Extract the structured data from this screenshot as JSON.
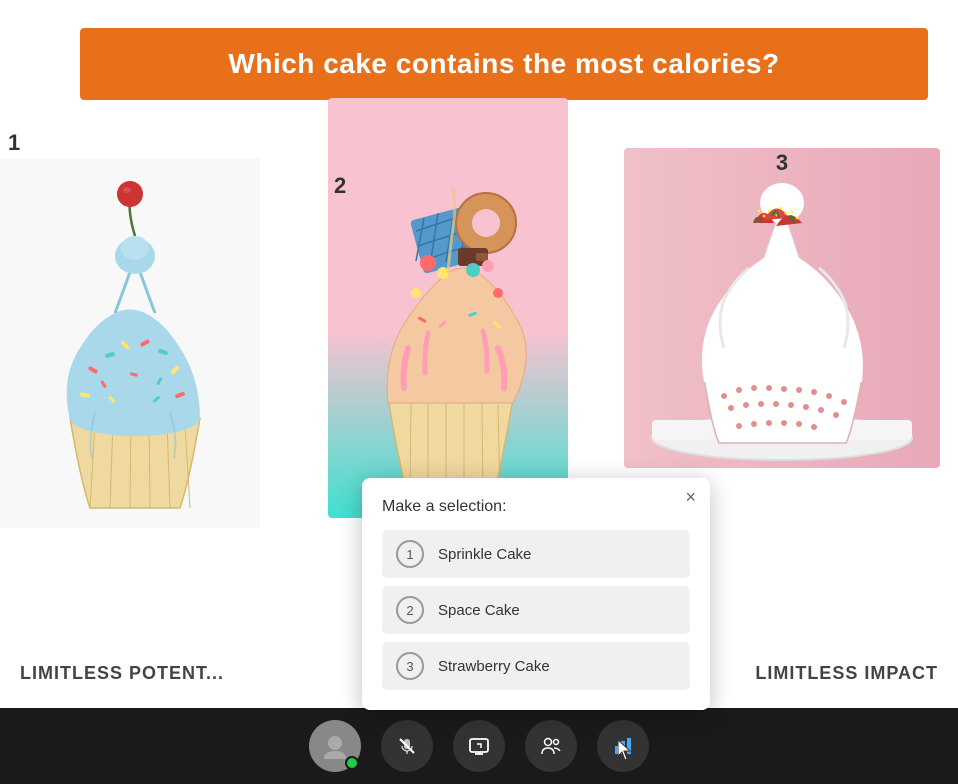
{
  "question": {
    "text": "Which cake contains the most calories?"
  },
  "cakes": [
    {
      "number": "1",
      "name": "Sprinkle Cake"
    },
    {
      "number": "2",
      "name": "Space Cake"
    },
    {
      "number": "3",
      "name": "Strawberry Cake"
    }
  ],
  "popup": {
    "title": "Make a selection:",
    "close_label": "×",
    "options": [
      {
        "number": "1",
        "label": "Sprinkle Cake"
      },
      {
        "number": "2",
        "label": "Space Cake"
      },
      {
        "number": "3",
        "label": "Strawberry Cake"
      }
    ]
  },
  "bottom_texts": {
    "left": "LIMITLESS POTENT...",
    "right": "LIMITLESS IMPACT"
  },
  "toolbar": {
    "buttons": [
      "avatar",
      "mic",
      "screen",
      "people",
      "chart"
    ]
  }
}
